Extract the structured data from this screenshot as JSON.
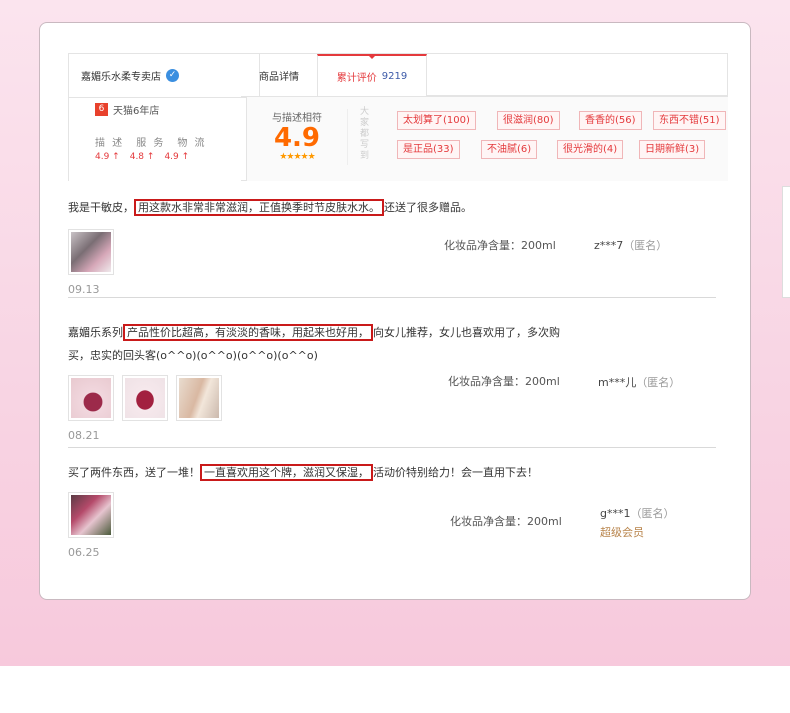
{
  "shop": {
    "name": "嘉媚乐水柔专卖店",
    "verify_glyph": "✓",
    "tmall_years_badge": "6",
    "tmall_years_label": "天猫6年店",
    "score_labels": [
      "描 述",
      "服 务",
      "物 流"
    ],
    "score_values": [
      "4.9 ↑",
      "4.8 ↑",
      "4.9 ↑"
    ]
  },
  "tabs": {
    "details_label": "商品详情",
    "reviews_label": "累计评价",
    "reviews_count": "9219"
  },
  "rating": {
    "match_label": "与描述相符",
    "match_score": "4.9",
    "stars": "★★★★★",
    "impression_label": "大家都写到",
    "tags": [
      "太划算了(100)",
      "很滋润(80)",
      "香香的(56)",
      "东西不错(51)",
      "是正品(33)",
      "不油腻(6)",
      "很光滑的(4)",
      "日期新鲜(3)"
    ]
  },
  "reviews": [
    {
      "pre": "我是干敏皮，",
      "highlight": "用这款水非常非常滋润，正值换季时节皮肤水水。",
      "post": "还送了很多赠品。",
      "date": "09.13",
      "spec": "化妆品净含量：200ml",
      "user": "z***7",
      "anon": "（匿名）",
      "vip": ""
    },
    {
      "pre": "嘉媚乐系列",
      "highlight": "产品性价比超高，有淡淡的香味，用起来也好用，",
      "post": "向女儿推荐，女儿也喜欢用了，多次购买，忠实的回头客(o^^o)(o^^o)(o^^o)(o^^o)",
      "date": "08.21",
      "spec": "化妆品净含量：200ml",
      "user": "m***儿",
      "anon": "（匿名）",
      "vip": ""
    },
    {
      "pre": "买了两件东西，送了一堆！",
      "highlight": "一直喜欢用这个牌，滋润又保湿，",
      "post": "活动价特别给力！会一直用下去！",
      "date": "06.25",
      "spec": "化妆品净含量：200ml",
      "user": "g***1",
      "anon": "（匿名）",
      "vip": "超级会员"
    }
  ]
}
